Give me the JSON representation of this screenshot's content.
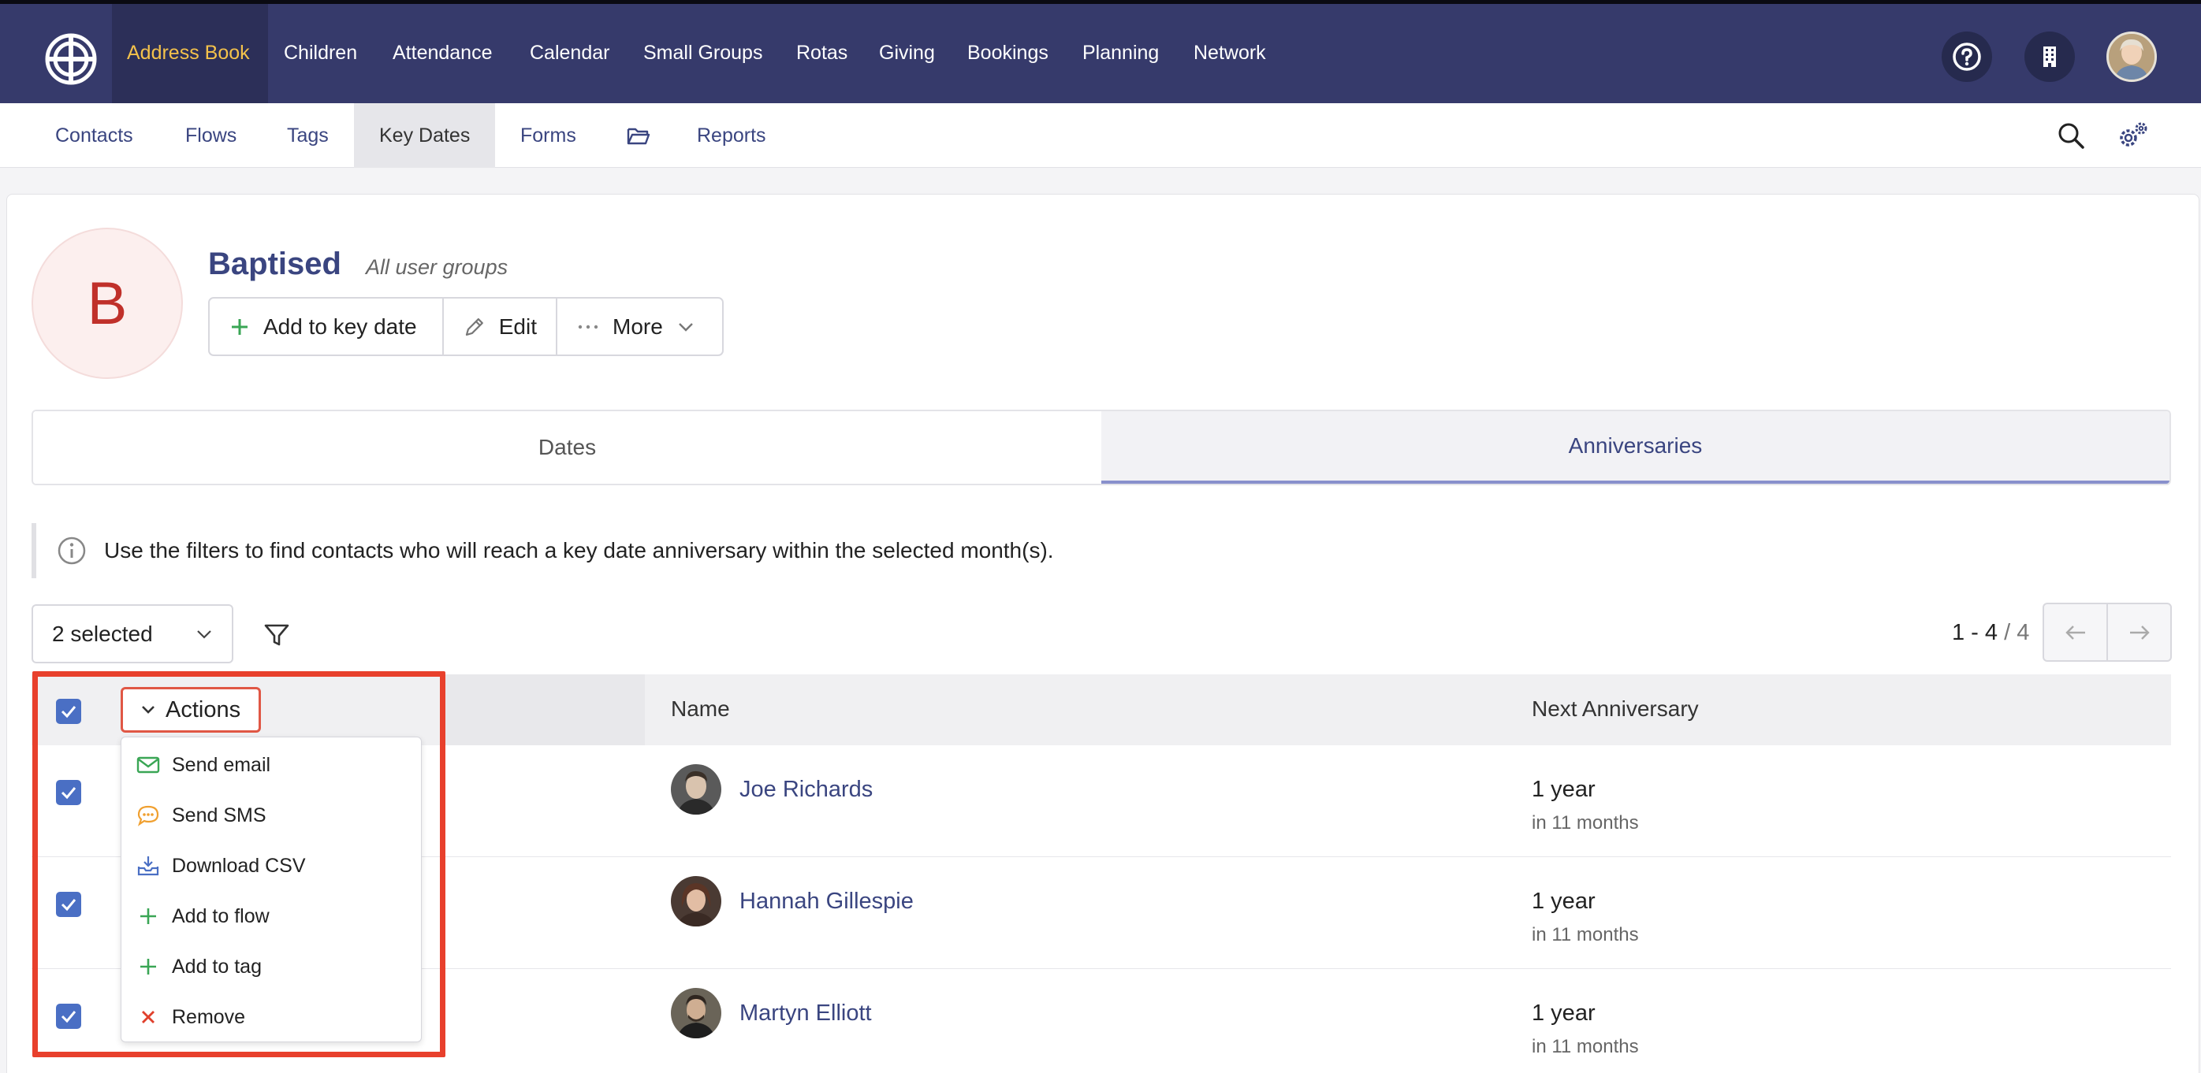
{
  "topnav": {
    "items": [
      "Address Book",
      "Children",
      "Attendance",
      "Calendar",
      "Small Groups",
      "Rotas",
      "Giving",
      "Bookings",
      "Planning",
      "Network"
    ],
    "active": "Address Book",
    "icons": [
      "help-icon",
      "building-icon",
      "user-avatar"
    ]
  },
  "subnav": {
    "items": [
      "Contacts",
      "Flows",
      "Tags",
      "Key Dates",
      "Forms",
      "Reports"
    ],
    "active": "Key Dates",
    "icons": [
      "search-icon",
      "settings-icon"
    ]
  },
  "keydate": {
    "initial": "B",
    "title": "Baptised",
    "subtitle": "All user groups",
    "buttons": {
      "add": "Add to key date",
      "edit": "Edit",
      "more": "More"
    }
  },
  "tabs": [
    "Dates",
    "Anniversaries"
  ],
  "active_tab": "Anniversaries",
  "info_text": "Use the filters to find contacts who will reach a key date anniversary within the selected month(s).",
  "filter": {
    "selected_label": "2 selected"
  },
  "pagination": {
    "range": "1 - 4",
    "separator": " / ",
    "total": "4"
  },
  "table": {
    "actions_label": "Actions",
    "columns": [
      "Name",
      "Next Anniversary"
    ],
    "rows": [
      {
        "name": "Joe Richards",
        "anniversary": "1 year",
        "when": "in 11 months",
        "checked": true
      },
      {
        "name": "Hannah Gillespie",
        "anniversary": "1 year",
        "when": "in 11 months",
        "checked": true
      },
      {
        "name": "Martyn Elliott",
        "anniversary": "1 year",
        "when": "in 11 months",
        "checked": true
      }
    ]
  },
  "actions_menu": [
    {
      "label": "Send email",
      "icon": "envelope-icon",
      "color": "#3aa655"
    },
    {
      "label": "Send SMS",
      "icon": "chat-bubble-icon",
      "color": "#f0a030"
    },
    {
      "label": "Download CSV",
      "icon": "download-icon",
      "color": "#4a6fc4"
    },
    {
      "label": "Add to flow",
      "icon": "plus-icon",
      "color": "#3aa655"
    },
    {
      "label": "Add to tag",
      "icon": "plus-icon",
      "color": "#3aa655"
    },
    {
      "label": "Remove",
      "icon": "close-icon",
      "color": "#e0402c"
    }
  ],
  "colors": {
    "topbar": "#363a6b",
    "accent": "#f4c24b",
    "link": "#3a4580",
    "checkbox": "#4a6fc4",
    "highlight": "#e8402c"
  }
}
